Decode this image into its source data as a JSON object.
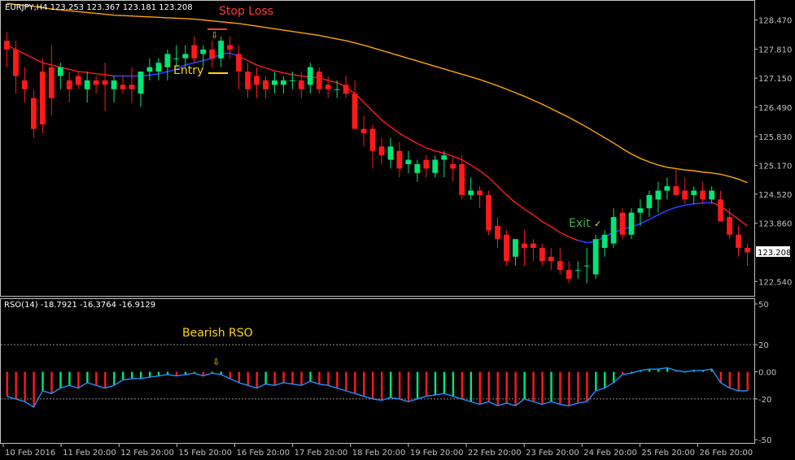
{
  "chart_data": {
    "type": "candlestick",
    "main": {
      "symbol_line": "EURJPY,H4  123.253 123.367 123.181 123.208",
      "ylim": [
        122.25,
        128.85
      ],
      "ticks": [
        "128.470",
        "127.810",
        "127.150",
        "126.490",
        "125.830",
        "125.170",
        "124.520",
        "123.860",
        "123.208",
        "122.540"
      ],
      "tick_values": [
        128.47,
        127.81,
        127.15,
        126.49,
        125.83,
        125.17,
        124.52,
        123.86,
        123.208,
        122.54
      ],
      "current_price": "123.208",
      "candles": [
        [
          128.0,
          128.2,
          127.4,
          127.8
        ],
        [
          127.8,
          128.0,
          126.8,
          127.2
        ],
        [
          127.1,
          127.4,
          126.6,
          126.9
        ],
        [
          126.7,
          126.9,
          125.8,
          126.0
        ],
        [
          127.3,
          127.6,
          125.9,
          126.1
        ],
        [
          127.4,
          127.9,
          126.3,
          126.7
        ],
        [
          127.2,
          127.5,
          126.9,
          127.4
        ],
        [
          127.1,
          127.3,
          126.6,
          126.9
        ],
        [
          127.2,
          127.3,
          126.9,
          127.0
        ],
        [
          126.9,
          127.3,
          126.6,
          127.1
        ],
        [
          127.1,
          127.2,
          126.8,
          127.0
        ],
        [
          127.1,
          127.5,
          126.4,
          127.0
        ],
        [
          126.9,
          127.2,
          126.6,
          127.1
        ],
        [
          127.0,
          127.2,
          126.8,
          126.9
        ],
        [
          127.0,
          127.4,
          126.6,
          126.9
        ],
        [
          126.8,
          127.3,
          126.5,
          127.3
        ],
        [
          127.3,
          127.6,
          127.1,
          127.4
        ],
        [
          127.3,
          127.6,
          127.1,
          127.5
        ],
        [
          127.4,
          127.8,
          127.1,
          127.7
        ],
        [
          127.6,
          127.9,
          127.4,
          127.6
        ],
        [
          127.6,
          127.9,
          127.4,
          127.7
        ],
        [
          127.9,
          128.1,
          127.5,
          127.6
        ],
        [
          127.7,
          127.9,
          127.4,
          127.8
        ],
        [
          127.8,
          128.0,
          127.4,
          127.6
        ],
        [
          127.6,
          128.1,
          127.4,
          128.0
        ],
        [
          127.9,
          128.1,
          127.6,
          127.8
        ],
        [
          127.7,
          127.9,
          126.9,
          127.3
        ],
        [
          127.3,
          127.5,
          126.7,
          126.9
        ],
        [
          127.2,
          127.4,
          126.7,
          127.0
        ],
        [
          127.1,
          127.2,
          126.7,
          126.9
        ],
        [
          127.0,
          127.3,
          126.8,
          127.1
        ],
        [
          127.0,
          127.2,
          126.8,
          127.1
        ],
        [
          127.1,
          127.3,
          126.9,
          127.1
        ],
        [
          127.1,
          127.3,
          126.7,
          126.9
        ],
        [
          127.0,
          127.5,
          126.8,
          127.4
        ],
        [
          127.3,
          127.4,
          126.8,
          126.9
        ],
        [
          127.0,
          127.2,
          126.7,
          126.9
        ],
        [
          126.9,
          127.1,
          126.7,
          126.9
        ],
        [
          127.0,
          127.2,
          126.7,
          126.8
        ],
        [
          126.8,
          127.1,
          126.0,
          126.0
        ],
        [
          126.0,
          126.3,
          125.6,
          125.9
        ],
        [
          126.0,
          126.1,
          125.1,
          125.5
        ],
        [
          125.6,
          125.8,
          125.2,
          125.4
        ],
        [
          125.3,
          125.8,
          125.1,
          125.6
        ],
        [
          125.5,
          125.7,
          124.9,
          125.1
        ],
        [
          125.2,
          125.5,
          125.0,
          125.3
        ],
        [
          125.0,
          125.3,
          124.8,
          125.2
        ],
        [
          125.3,
          125.4,
          124.9,
          125.1
        ],
        [
          125.0,
          125.4,
          124.9,
          125.3
        ],
        [
          125.3,
          125.5,
          124.9,
          125.4
        ],
        [
          125.2,
          125.4,
          124.8,
          125.1
        ],
        [
          125.2,
          125.4,
          124.4,
          124.5
        ],
        [
          124.5,
          124.9,
          124.4,
          124.6
        ],
        [
          124.6,
          124.7,
          124.2,
          124.5
        ],
        [
          124.5,
          124.6,
          123.6,
          123.7
        ],
        [
          123.8,
          124.0,
          123.3,
          123.5
        ],
        [
          123.6,
          123.7,
          122.9,
          123.0
        ],
        [
          123.1,
          123.5,
          122.9,
          123.5
        ],
        [
          123.4,
          123.7,
          122.9,
          123.3
        ],
        [
          123.4,
          123.5,
          123.0,
          123.3
        ],
        [
          123.3,
          123.4,
          122.9,
          123.0
        ],
        [
          123.1,
          123.3,
          122.8,
          123.0
        ],
        [
          123.0,
          123.3,
          122.7,
          122.8
        ],
        [
          122.8,
          123.0,
          122.5,
          122.6
        ],
        [
          122.8,
          123.0,
          122.6,
          122.8
        ],
        [
          122.9,
          123.3,
          122.5,
          122.9
        ],
        [
          122.7,
          123.6,
          122.6,
          123.5
        ],
        [
          123.3,
          123.7,
          123.1,
          123.6
        ],
        [
          123.4,
          124.2,
          123.3,
          124.0
        ],
        [
          124.1,
          124.2,
          123.5,
          123.6
        ],
        [
          123.6,
          124.2,
          123.5,
          124.1
        ],
        [
          124.1,
          124.4,
          123.8,
          124.2
        ],
        [
          124.2,
          124.6,
          124.0,
          124.5
        ],
        [
          124.4,
          124.8,
          124.1,
          124.6
        ],
        [
          124.6,
          124.9,
          124.4,
          124.7
        ],
        [
          124.7,
          125.1,
          124.5,
          124.5
        ],
        [
          124.6,
          124.9,
          124.3,
          124.4
        ],
        [
          124.5,
          124.7,
          124.3,
          124.6
        ],
        [
          124.6,
          124.8,
          124.3,
          124.4
        ],
        [
          124.4,
          124.7,
          124.3,
          124.6
        ],
        [
          124.4,
          124.6,
          123.9,
          123.9
        ],
        [
          124.0,
          124.2,
          123.5,
          123.6
        ],
        [
          123.6,
          123.8,
          123.1,
          123.3
        ],
        [
          123.3,
          123.4,
          122.9,
          123.2
        ]
      ],
      "ema_red": [
        127.9,
        127.8,
        127.7,
        127.6,
        127.5,
        127.45,
        127.4,
        127.35,
        127.3,
        127.28,
        127.25,
        127.23,
        127.2,
        127.2,
        127.2,
        127.2,
        127.22,
        127.25,
        127.3,
        127.35,
        127.45,
        127.5,
        127.55,
        127.6,
        127.7,
        127.72,
        127.65,
        127.55,
        127.45,
        127.38,
        127.32,
        127.27,
        127.23,
        127.2,
        127.18,
        127.16,
        127.1,
        127.05,
        126.95,
        126.8,
        126.6,
        126.4,
        126.2,
        126.05,
        125.9,
        125.78,
        125.67,
        125.57,
        125.5,
        125.45,
        125.38,
        125.3,
        125.18,
        125.05,
        124.9,
        124.7,
        124.5,
        124.33,
        124.18,
        124.05,
        123.9,
        123.78,
        123.65,
        123.55,
        123.47,
        123.42,
        123.45,
        123.55,
        123.65,
        123.72,
        123.78,
        123.85,
        123.95,
        124.05,
        124.15,
        124.22,
        124.27,
        124.3,
        124.32,
        124.33,
        124.25,
        124.1,
        123.95,
        123.8
      ],
      "blue_segments": [
        [
          12,
          26
        ],
        [
          64,
          79
        ]
      ],
      "ema_orange": [
        128.85,
        128.82,
        128.8,
        128.78,
        128.75,
        128.72,
        128.7,
        128.68,
        128.66,
        128.64,
        128.62,
        128.6,
        128.58,
        128.57,
        128.56,
        128.55,
        128.54,
        128.53,
        128.52,
        128.51,
        128.5,
        128.49,
        128.47,
        128.45,
        128.43,
        128.41,
        128.39,
        128.36,
        128.33,
        128.3,
        128.27,
        128.24,
        128.21,
        128.18,
        128.15,
        128.12,
        128.08,
        128.04,
        128.0,
        127.95,
        127.9,
        127.84,
        127.78,
        127.72,
        127.66,
        127.6,
        127.54,
        127.48,
        127.42,
        127.36,
        127.3,
        127.24,
        127.18,
        127.12,
        127.05,
        126.98,
        126.9,
        126.82,
        126.74,
        126.65,
        126.56,
        126.46,
        126.36,
        126.26,
        126.15,
        126.04,
        125.92,
        125.8,
        125.68,
        125.55,
        125.43,
        125.33,
        125.25,
        125.18,
        125.13,
        125.1,
        125.07,
        125.05,
        125.02,
        125.0,
        124.97,
        124.92,
        124.86,
        124.78
      ]
    },
    "annotations": {
      "stop_loss": "Stop Loss",
      "entry": "Entry",
      "exit": "Exit",
      "bearish_rso": "Bearish RSO",
      "down_arrow": "⇩",
      "check": "✓"
    },
    "rso": {
      "label": "RSO(14) -18.7921 -16.3764 -16.9129",
      "ylim": [
        -50,
        50
      ],
      "ticks": [
        "50",
        "20",
        "0.00",
        "-20",
        "-50"
      ],
      "tick_values": [
        50,
        20,
        0,
        -20,
        -50
      ],
      "bars": [
        -18,
        -20,
        -22,
        -26,
        -14,
        -16,
        -12,
        -10,
        -12,
        -8,
        -10,
        -12,
        -10,
        -6,
        -5,
        -5,
        -4,
        -3,
        -2,
        -3,
        -2,
        -1,
        -3,
        -1,
        -2,
        -5,
        -8,
        -10,
        -12,
        -9,
        -10,
        -8,
        -9,
        -10,
        -7,
        -9,
        -10,
        -12,
        -14,
        -16,
        -18,
        -20,
        -21,
        -19,
        -20,
        -22,
        -20,
        -18,
        -17,
        -16,
        -18,
        -20,
        -22,
        -24,
        -22,
        -25,
        -23,
        -25,
        -20,
        -22,
        -24,
        -22,
        -24,
        -25,
        -23,
        -22,
        -14,
        -12,
        -8,
        -2,
        -1,
        1,
        2,
        2,
        3,
        1,
        0,
        1,
        1,
        2,
        -8,
        -12,
        -14,
        -14
      ],
      "bar_colors": [
        "r",
        "r",
        "r",
        "r",
        "g",
        "r",
        "g",
        "g",
        "r",
        "g",
        "r",
        "r",
        "g",
        "g",
        "g",
        "g",
        "g",
        "g",
        "g",
        "r",
        "g",
        "g",
        "r",
        "g",
        "g",
        "r",
        "r",
        "r",
        "r",
        "g",
        "r",
        "r",
        "r",
        "r",
        "g",
        "r",
        "r",
        "r",
        "r",
        "r",
        "r",
        "r",
        "r",
        "g",
        "r",
        "r",
        "g",
        "r",
        "g",
        "g",
        "g",
        "r",
        "g",
        "r",
        "r",
        "r",
        "r",
        "r",
        "g",
        "r",
        "r",
        "g",
        "r",
        "r",
        "r",
        "r",
        "g",
        "g",
        "g",
        "r",
        "g",
        "g",
        "g",
        "g",
        "g",
        "r",
        "g",
        "g",
        "g",
        "g",
        "r",
        "r",
        "r",
        "r"
      ],
      "line": [
        -18,
        -20,
        -22,
        -26,
        -14,
        -16,
        -12,
        -10,
        -12,
        -8,
        -10,
        -12,
        -10,
        -6,
        -5,
        -5,
        -4,
        -3,
        -2,
        -3,
        -2,
        -1,
        -3,
        -1,
        -2,
        -5,
        -8,
        -10,
        -12,
        -9,
        -10,
        -8,
        -9,
        -10,
        -7,
        -9,
        -10,
        -12,
        -14,
        -16,
        -18,
        -20,
        -21,
        -19,
        -20,
        -22,
        -20,
        -18,
        -17,
        -16,
        -18,
        -20,
        -22,
        -24,
        -22,
        -25,
        -23,
        -25,
        -20,
        -22,
        -24,
        -22,
        -24,
        -25,
        -23,
        -22,
        -14,
        -12,
        -8,
        -2,
        -1,
        1,
        2,
        2,
        3,
        1,
        0,
        1,
        1,
        2,
        -8,
        -12,
        -14,
        -14
      ]
    },
    "x_labels": [
      "10 Feb 2016",
      "11 Feb 20:00",
      "12 Feb 20:00",
      "15 Feb 20:00",
      "16 Feb 20:00",
      "17 Feb 20:00",
      "18 Feb 20:00",
      "19 Feb 20:00",
      "22 Feb 20:00",
      "23 Feb 20:00",
      "24 Feb 20:00",
      "25 Feb 20:00",
      "26 Feb 20:00"
    ],
    "colors": {
      "bull": "#00e676",
      "bear": "#ff1a1a",
      "ema_red": "#ff1a1a",
      "ema_orange": "#ffa500",
      "blue": "#1e3cff",
      "rso_line": "#1e90ff",
      "annot_red": "#ff3b3b",
      "annot_yellow": "#ffd700",
      "annot_green": "#4caf50",
      "axis": "#c0c0c0"
    }
  }
}
